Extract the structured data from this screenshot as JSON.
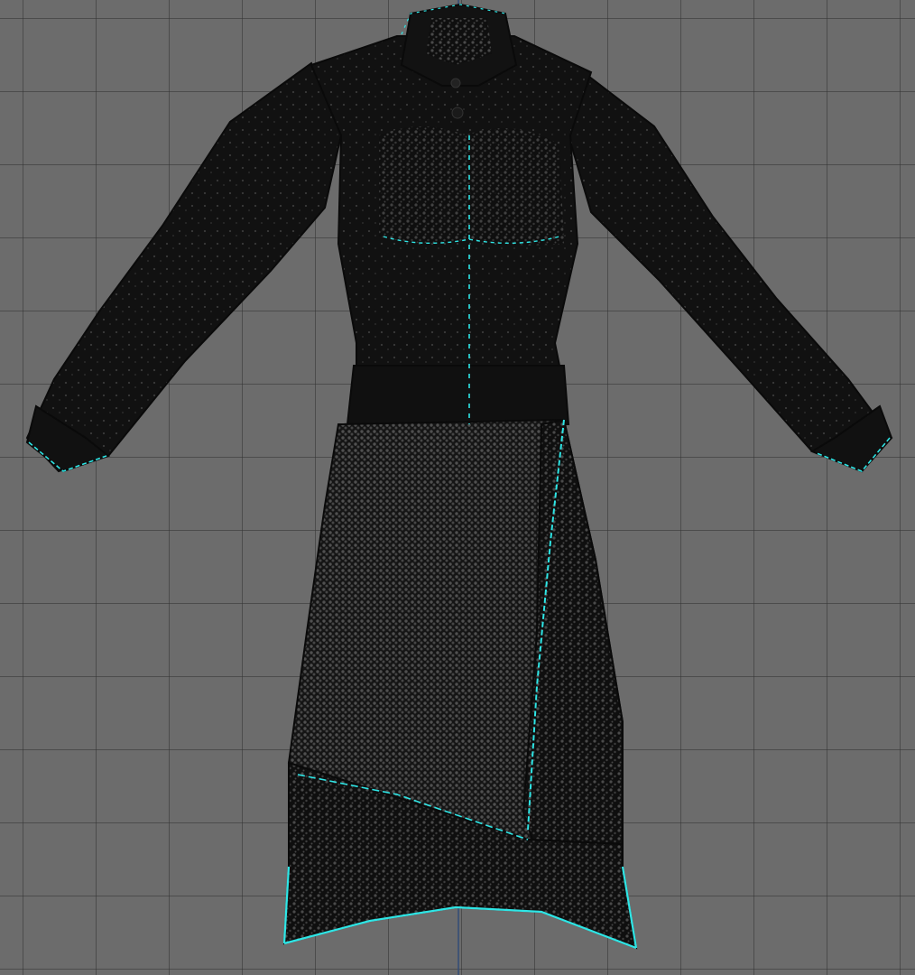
{
  "viewport": {
    "background_color": "#6c6c6c",
    "grid_color": "#3a3a3a",
    "axis_line_color": "#2f4a78"
  },
  "model": {
    "garment_color": "#0d0d0d",
    "mesh_point_color": "#4a4a4a",
    "selection_color": "#2ee6e6"
  }
}
